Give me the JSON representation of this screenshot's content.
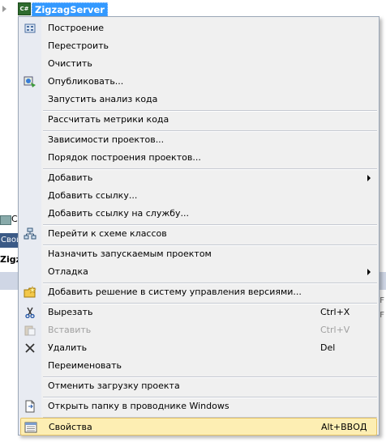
{
  "tree": {
    "project_label": "ZigzagServer",
    "project_icon_text": "C#"
  },
  "background": {
    "row1_text": "C",
    "bar_text": "Свой",
    "tab_text": "Zigz",
    "right_text_1": "F",
    "right_text_2": "F"
  },
  "menu": {
    "items": [
      {
        "label": "Построение",
        "icon": "build-icon"
      },
      {
        "label": "Перестроить"
      },
      {
        "label": "Очистить"
      },
      {
        "label": "Опубликовать...",
        "icon": "publish-icon"
      },
      {
        "label": "Запустить анализ кода"
      },
      {
        "label": "Рассчитать метрики кода"
      },
      {
        "label": "Зависимости проектов..."
      },
      {
        "label": "Порядок построения проектов..."
      },
      {
        "label": "Добавить",
        "submenu": true
      },
      {
        "label": "Добавить ссылку..."
      },
      {
        "label": "Добавить ссылку на службу..."
      },
      {
        "label": "Перейти к схеме классов",
        "icon": "class-diagram-icon"
      },
      {
        "label": "Назначить запускаемым проектом"
      },
      {
        "label": "Отладка",
        "submenu": true
      },
      {
        "label": "Добавить решение в систему управления версиями...",
        "icon": "source-control-icon"
      },
      {
        "label": "Вырезать",
        "shortcut": "Ctrl+X",
        "icon": "scissors-icon"
      },
      {
        "label": "Вставить",
        "shortcut": "Ctrl+V",
        "icon": "paste-icon",
        "disabled": true
      },
      {
        "label": "Удалить",
        "shortcut": "Del",
        "icon": "delete-icon"
      },
      {
        "label": "Переименовать"
      },
      {
        "label": "Отменить загрузку проекта"
      },
      {
        "label": "Открыть папку в проводнике Windows",
        "icon": "folder-open-icon"
      },
      {
        "label": "Свойства",
        "shortcut": "Alt+ВВОД",
        "icon": "properties-icon",
        "highlighted": true
      }
    ]
  },
  "colors": {
    "highlight_bg": "#fdeeb3",
    "highlight_border": "#e5c365",
    "selection": "#3399ff",
    "menu_bg": "#f0f0f0"
  }
}
